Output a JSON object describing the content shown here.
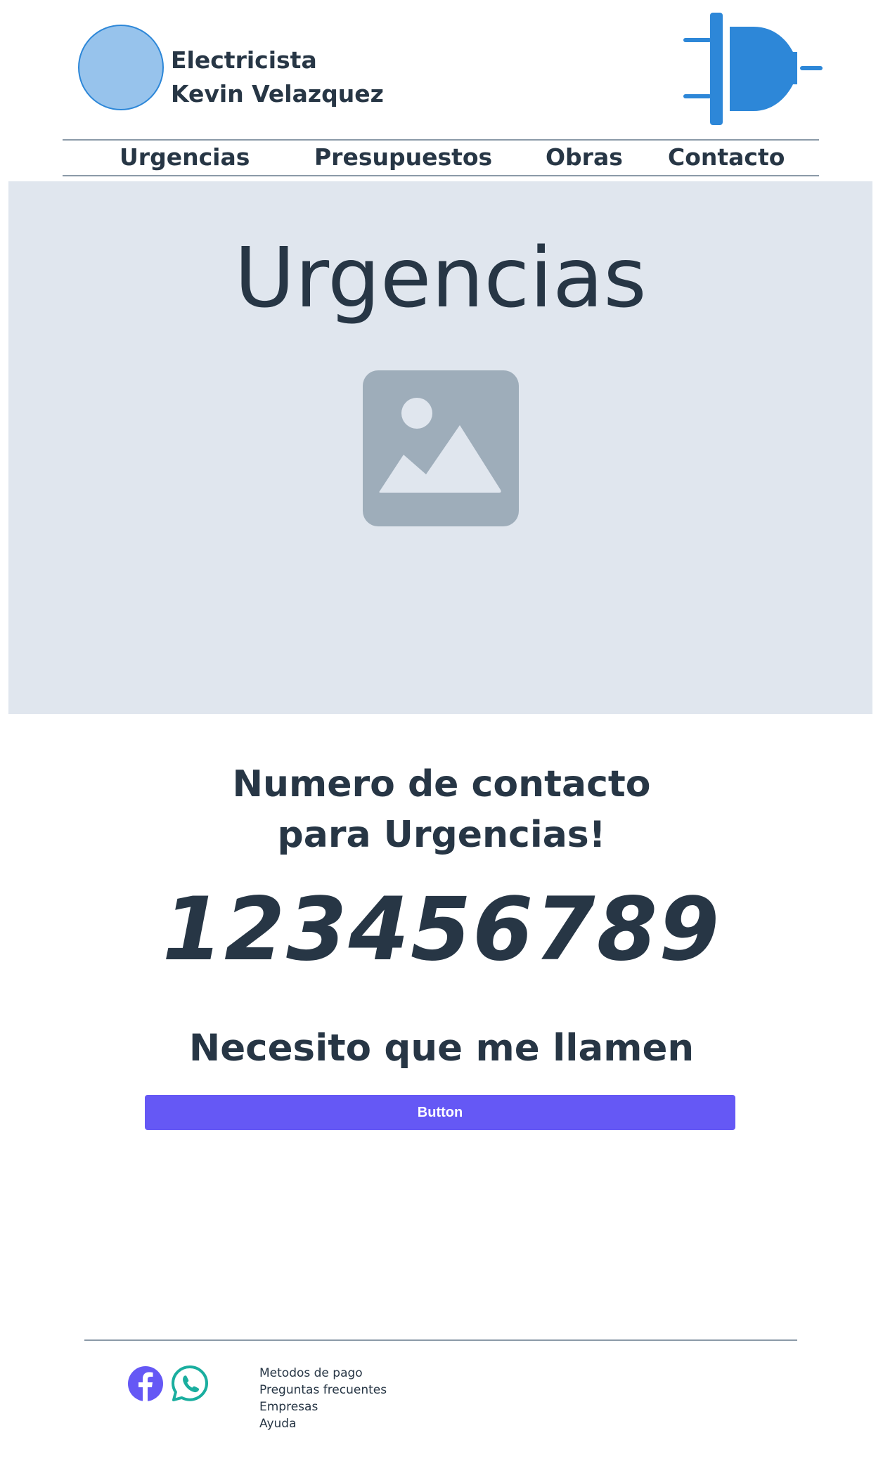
{
  "header": {
    "brand_line1": "Electricista",
    "brand_line2": "Kevin Velazquez",
    "logo_icon": "plug-icon"
  },
  "nav": {
    "items": [
      {
        "label": "Urgencias"
      },
      {
        "label": "Presupuestos"
      },
      {
        "label": "Obras"
      },
      {
        "label": "Contacto"
      }
    ]
  },
  "hero": {
    "title": "Urgencias",
    "image_icon": "image-placeholder-icon"
  },
  "contact": {
    "heading_line1": "Numero de contacto",
    "heading_line2": "para Urgencias!",
    "phone": "123456789",
    "callback_heading": "Necesito que me llamen",
    "button_label": "Button"
  },
  "footer": {
    "social": [
      {
        "icon": "facebook-icon"
      },
      {
        "icon": "whatsapp-icon"
      }
    ],
    "links": [
      {
        "label": "Metodos de pago"
      },
      {
        "label": "Preguntas frecuentes"
      },
      {
        "label": "Empresas"
      },
      {
        "label": "Ayuda"
      }
    ]
  },
  "colors": {
    "text": "#273645",
    "accent_blue": "#2d87d8",
    "logo_fill": "#97c3ec",
    "hero_bg": "#e0e6ee",
    "button": "#6558f5",
    "facebook": "#6558f5",
    "whatsapp": "#1aae9f",
    "placeholder": "#9eadba"
  }
}
